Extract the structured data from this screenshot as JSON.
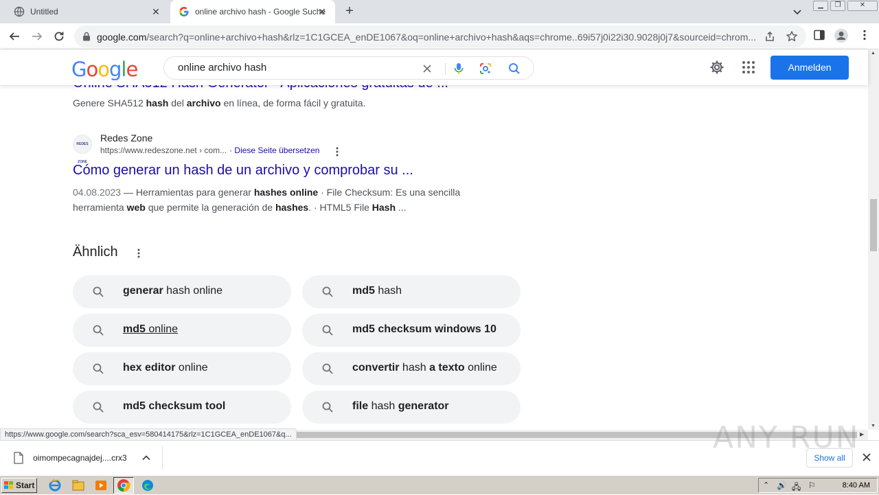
{
  "browser": {
    "tabs": [
      {
        "title": "Untitled",
        "active": false
      },
      {
        "title": "online archivo hash - Google Suche",
        "active": true
      }
    ],
    "url_host": "google.com",
    "url_path": "/search?q=online+archivo+hash&rlz=1C1GCEA_enDE1067&oq=online+archivo+hash&aqs=chrome..69i57j0i22i30.9028j0j7&sourceid=chrom..."
  },
  "google": {
    "logo_text": "Google",
    "query": "online archivo hash",
    "signin_label": "Anmelden"
  },
  "results": {
    "partial_title": "Online SHA512 Hash Generator - Aplicaciones gratuitas de ...",
    "partial_snippet_parts": [
      "Genere SHA512 ",
      "hash",
      " del ",
      "archivo",
      " en línea, de forma fácil y gratuita."
    ],
    "site": {
      "favicon_text": "REDES ZONE",
      "name": "Redes Zone",
      "url": "https://www.redeszone.net › com...",
      "translate": "· Diese Seite übersetzen"
    },
    "title": "Cómo generar un hash de un archivo y comprobar su ...",
    "snippet": {
      "date": "04.08.2023",
      "parts": [
        " — Herramientas para generar ",
        "hashes online",
        " · File Checksum: Es una sencilla herramienta ",
        "web",
        " que permite la generación de ",
        "hashes",
        ". · HTML5 File ",
        "Hash",
        " ..."
      ]
    }
  },
  "similar": {
    "heading": "Ähnlich",
    "chips": [
      {
        "bold": "generar",
        "rest": " hash online"
      },
      {
        "bold": "md5",
        "rest": " hash"
      },
      {
        "bold": "md5",
        "rest": " online"
      },
      {
        "bold": "md5 checksum windows 10",
        "rest": ""
      },
      {
        "bold": "hex editor",
        "rest": " online"
      },
      {
        "bold": "convertir",
        "rest": " hash ",
        "bold2": "a texto",
        "rest2": " online"
      },
      {
        "bold": "md5 checksum tool",
        "rest": ""
      },
      {
        "bold": "file",
        "rest": " hash ",
        "bold2": "generator",
        "rest2": ""
      }
    ]
  },
  "status_url": "https://www.google.com/search?sca_esv=580414175&rlz=1C1GCEA_enDE1067&q...",
  "download": {
    "filename": "oimompecagnajdej....crx3",
    "show_all_label": "Show all"
  },
  "watermark": "ANY RUN",
  "taskbar": {
    "start_label": "Start",
    "clock": "8:40 AM"
  },
  "colors": {
    "link": "#1a0dab",
    "accent": "#1a73e8",
    "chip_bg": "#f1f3f4"
  }
}
